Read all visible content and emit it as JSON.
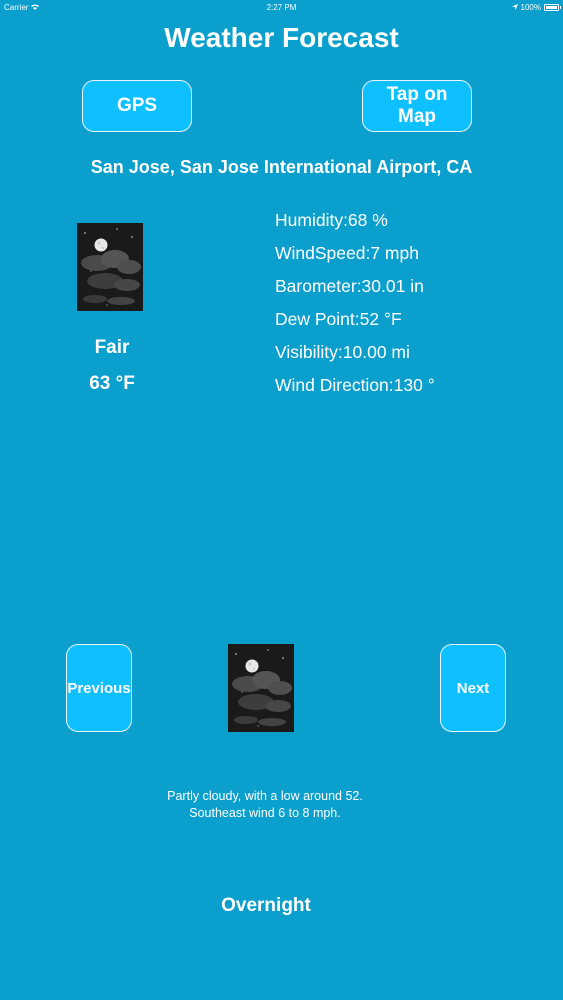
{
  "status_bar": {
    "carrier": "Carrier",
    "time": "2:27 PM",
    "battery": "100%"
  },
  "header": {
    "title": "Weather Forecast"
  },
  "buttons": {
    "gps_label": "GPS",
    "map_label": "Tap on Map",
    "previous_label": "Previous",
    "next_label": "Next"
  },
  "location": "San Jose, San Jose International Airport, CA",
  "current": {
    "condition": "Fair",
    "temperature": "63 °F",
    "icon": "night-partly-cloudy-icon",
    "details": [
      "Humidity:68 %",
      "WindSpeed:7 mph",
      "Barometer:30.01 in",
      "Dew Point:52 °F",
      "Visibility:10.00 mi",
      "Wind Direction:130 °"
    ]
  },
  "forecast": {
    "icon": "night-partly-cloudy-icon",
    "text_line1": "Partly cloudy, with a low around 52.",
    "text_line2": "Southeast wind 6 to 8 mph.",
    "period": "Overnight"
  },
  "colors": {
    "background": "#0a9fcc",
    "button": "#0ec0ff",
    "text": "#ffffff"
  }
}
